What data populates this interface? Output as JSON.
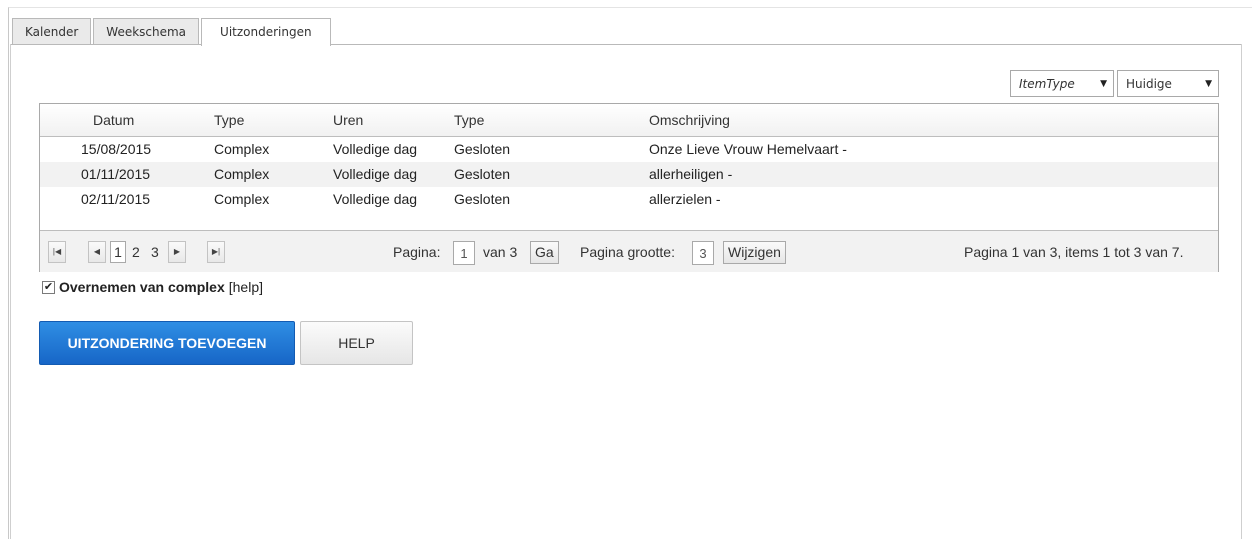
{
  "tabs": [
    {
      "label": "Kalender",
      "active": false
    },
    {
      "label": "Weekschema",
      "active": false
    },
    {
      "label": "Uitzonderingen",
      "active": true
    }
  ],
  "filters": {
    "itemtype": {
      "selected": "ItemType"
    },
    "period": {
      "selected": "Huidige"
    }
  },
  "grid": {
    "columns": [
      "Datum",
      "Type",
      "Uren",
      "Type",
      "Omschrijving"
    ],
    "rows": [
      {
        "datum": "15/08/2015",
        "type": "Complex",
        "uren": "Volledige dag",
        "type2": "Gesloten",
        "omschrijving": "Onze Lieve Vrouw Hemelvaart -"
      },
      {
        "datum": "01/11/2015",
        "type": "Complex",
        "uren": "Volledige dag",
        "type2": "Gesloten",
        "omschrijving": "allerheiligen -"
      },
      {
        "datum": "02/11/2015",
        "type": "Complex",
        "uren": "Volledige dag",
        "type2": "Gesloten",
        "omschrijving": "allerzielen -"
      }
    ]
  },
  "pager": {
    "pages": [
      "1",
      "2",
      "3"
    ],
    "page_label": "Pagina:",
    "page_value": "1",
    "of_label": "van 3",
    "go_label": "Ga",
    "size_label": "Pagina grootte:",
    "size_value": "3",
    "change_label": "Wijzigen",
    "summary": "Pagina 1 van 3, items 1 tot 3 van 7."
  },
  "inherit": {
    "checked": true,
    "check_glyph": "✔",
    "label": "Overnemen van complex",
    "help": "[help]"
  },
  "buttons": {
    "add": "UITZONDERING TOEVOEGEN",
    "help": "HELP"
  },
  "colors": {
    "primary": "#1f7ad6",
    "alt_row": "#f2f2f2"
  }
}
